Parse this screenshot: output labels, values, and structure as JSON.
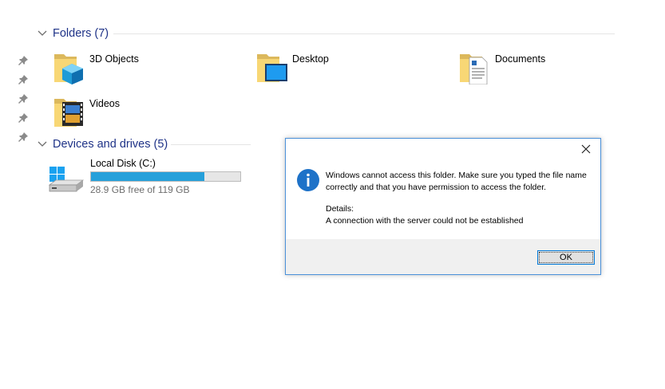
{
  "quick_access": {
    "pin_count": 5
  },
  "folders_group": {
    "title": "Folders (7)",
    "items": [
      {
        "label": "3D Objects",
        "icon": "3d-objects-folder-icon"
      },
      {
        "label": "Desktop",
        "icon": "desktop-folder-icon"
      },
      {
        "label": "Documents",
        "icon": "documents-folder-icon"
      },
      {
        "label": "Videos",
        "icon": "videos-folder-icon"
      }
    ]
  },
  "devices_group": {
    "title": "Devices and drives (5)",
    "drive": {
      "name": "Local Disk (C:)",
      "free_text": "28.9 GB free of 119 GB",
      "used_fraction": 0.757,
      "bar_color": "#26a0da"
    }
  },
  "dialog": {
    "message_line1": "Windows cannot access this folder. Make sure you typed the file name",
    "message_line2": "correctly and that you have permission to access the folder.",
    "details_label": "Details:",
    "details_text": "A connection with the server could not be established",
    "ok_label": "OK",
    "accent": "#1e72c8"
  }
}
